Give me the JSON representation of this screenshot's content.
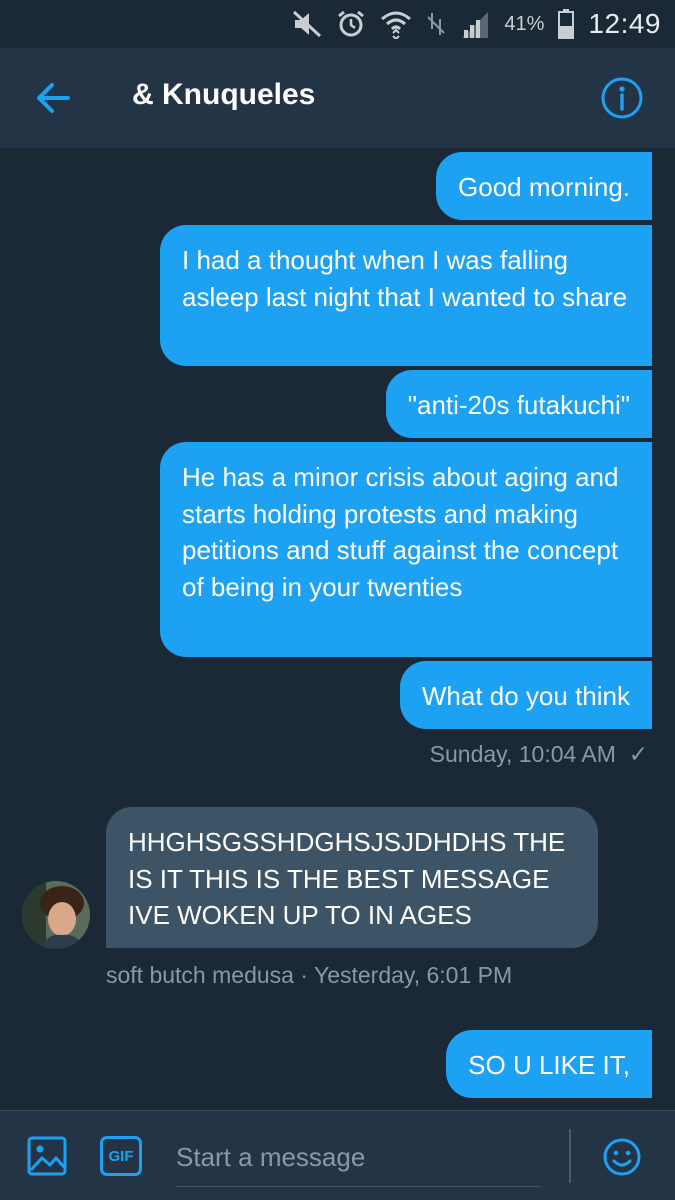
{
  "status_bar": {
    "battery_percent": "41%",
    "time": "12:49",
    "icons": [
      "mute-icon",
      "alarm-icon",
      "wifi-icon",
      "data-off-icon",
      "signal-icon",
      "battery-icon"
    ]
  },
  "header": {
    "title": "& Knuqueles",
    "back_icon": "arrow-left-icon",
    "info_icon": "info-icon"
  },
  "messages": [
    {
      "direction": "out",
      "text": "Good morning."
    },
    {
      "direction": "out",
      "text": "I had a thought when I was falling asleep last night that I wanted to share"
    },
    {
      "direction": "out",
      "text": "\"anti-20s futakuchi\""
    },
    {
      "direction": "out",
      "text": "He has a minor crisis about aging and starts holding protests and making petitions and stuff against the concept of being in your twenties"
    },
    {
      "direction": "out",
      "text": "What do you think"
    },
    {
      "direction": "in",
      "text": "HHGHSGSSHDGHSJSJDHDHS THE IS IT THIS IS THE BEST MESSAGE IVE WOKEN UP TO IN AGES"
    },
    {
      "direction": "out",
      "text": "SO U LIKE IT,"
    }
  ],
  "meta": {
    "sent_time": "Sunday, 10:04 AM",
    "sent_check": "✓",
    "received_info": "soft butch medusa · Yesterday, 6:01 PM"
  },
  "composer": {
    "placeholder": "Start a message",
    "gif_label": "GIF"
  },
  "colors": {
    "background": "#1b2836",
    "header": "#243447",
    "outgoing_bubble": "#1da1f2",
    "incoming_bubble": "#3d5366",
    "accent": "#1da1f2",
    "meta_text": "#8899a6"
  }
}
